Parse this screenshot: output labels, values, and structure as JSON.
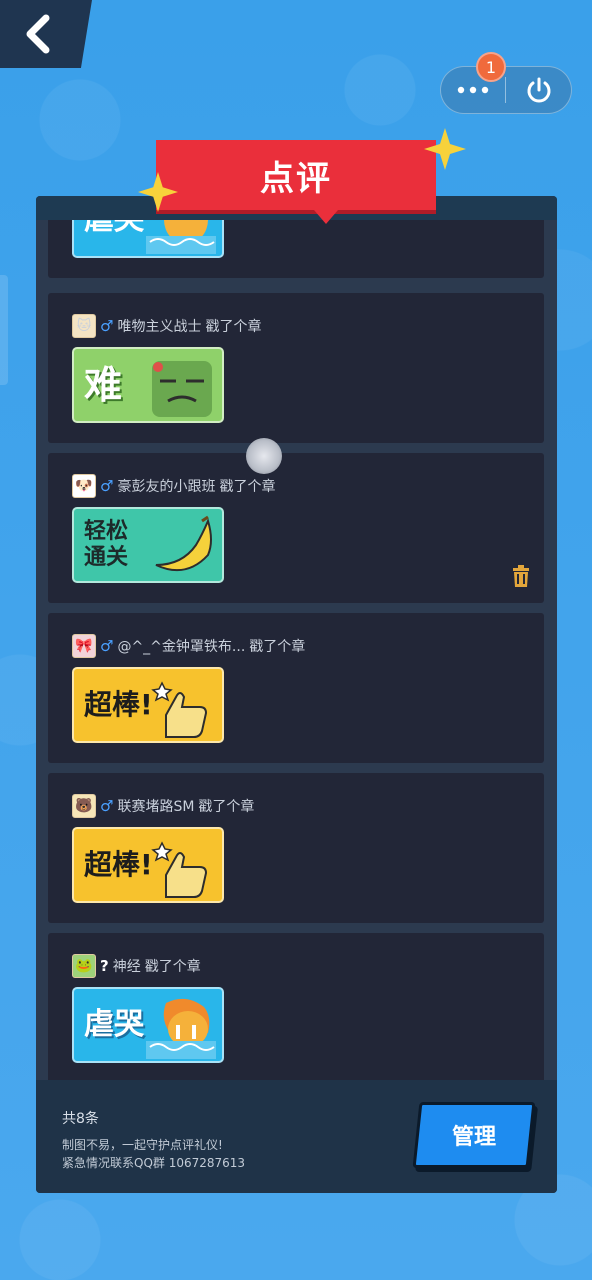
{
  "header": {
    "title": "点评",
    "badge_count": "1"
  },
  "list": {
    "partial_top_sticker_text": "虐哭",
    "cards": [
      {
        "name": "唯物主义战士",
        "action": "戳了个章",
        "gender": "♂",
        "avatar": "🐱",
        "sticker": "难",
        "sticker_color": "#8fd16a"
      },
      {
        "name": "豪彭友的小跟班",
        "action": "戳了个章",
        "gender": "♂",
        "avatar": "🐶",
        "sticker": "轻松\n通关",
        "sticker_color": "#3fc6a9"
      },
      {
        "name": "@^_^金钟罩铁布...",
        "action": "戳了个章",
        "gender": "♂",
        "avatar": "🎀",
        "sticker": "超棒!",
        "sticker_color": "#f7c22d"
      },
      {
        "name": "联赛堵路SM",
        "action": "戳了个章",
        "gender": "♂",
        "avatar": "🐻",
        "sticker": "超棒!",
        "sticker_color": "#f7c22d"
      },
      {
        "name": "神经",
        "action": "戳了个章",
        "gender": "?",
        "avatar": "🐸",
        "sticker": "虐哭",
        "sticker_color": "#29b6ea"
      }
    ]
  },
  "footer": {
    "total": "共8条",
    "note1": "制图不易，一起守护点评礼仪!",
    "note2": "紧急情况联系QQ群 1067287613",
    "manage_label": "管理"
  }
}
